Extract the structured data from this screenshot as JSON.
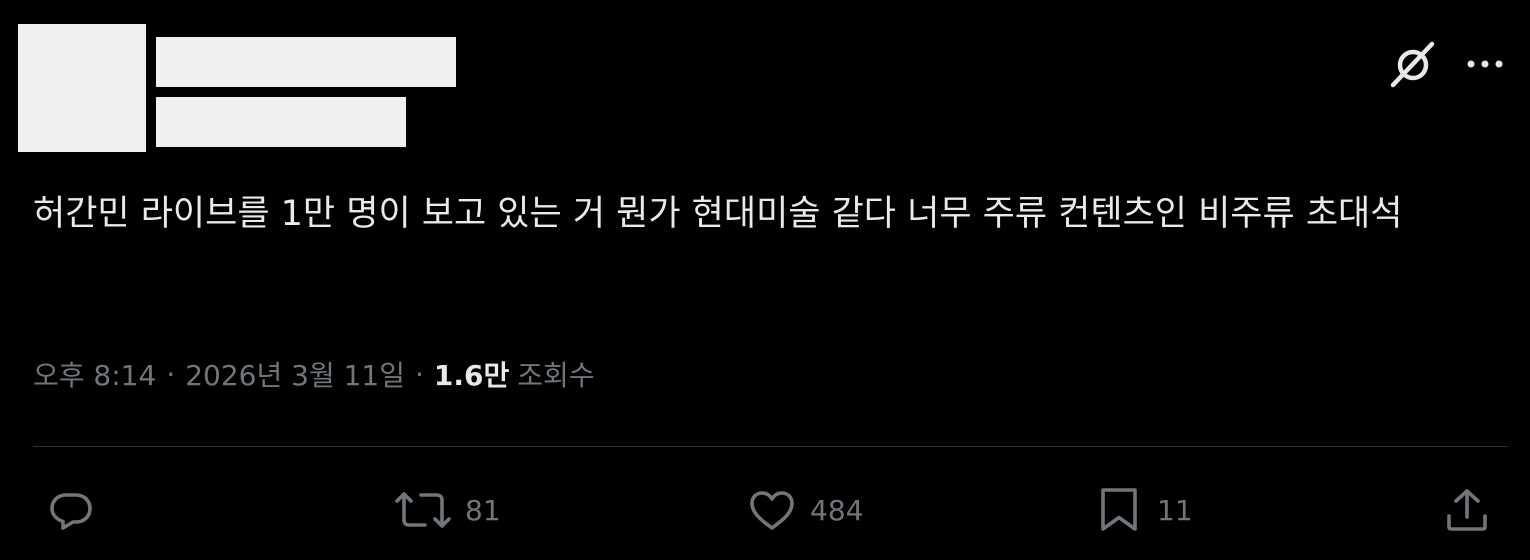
{
  "tweet": {
    "text": "허간민 라이브를 1만 명이 보고 있는 거 뭔가 현대미술 같다 너무 주류 컨텐츠인 비주류 초대석",
    "time": "오후 8:14",
    "date": "2026년 3월 11일",
    "separator": "·",
    "views_count": "1.6만",
    "views_label": "조회수"
  },
  "header": {
    "grok_icon": "grok-slash-icon",
    "more_icon": "more-dots-icon"
  },
  "actions": {
    "reply": {
      "icon": "reply-bubble-icon",
      "count": ""
    },
    "retweet": {
      "icon": "retweet-icon",
      "count": "81"
    },
    "like": {
      "icon": "heart-icon",
      "count": "484"
    },
    "bookmark": {
      "icon": "bookmark-icon",
      "count": "11"
    },
    "share": {
      "icon": "share-upload-icon"
    }
  },
  "colors": {
    "background": "#000000",
    "text": "#e7e9ea",
    "muted": "#71767b",
    "divider": "#2f3336",
    "redaction": "#efefef"
  }
}
